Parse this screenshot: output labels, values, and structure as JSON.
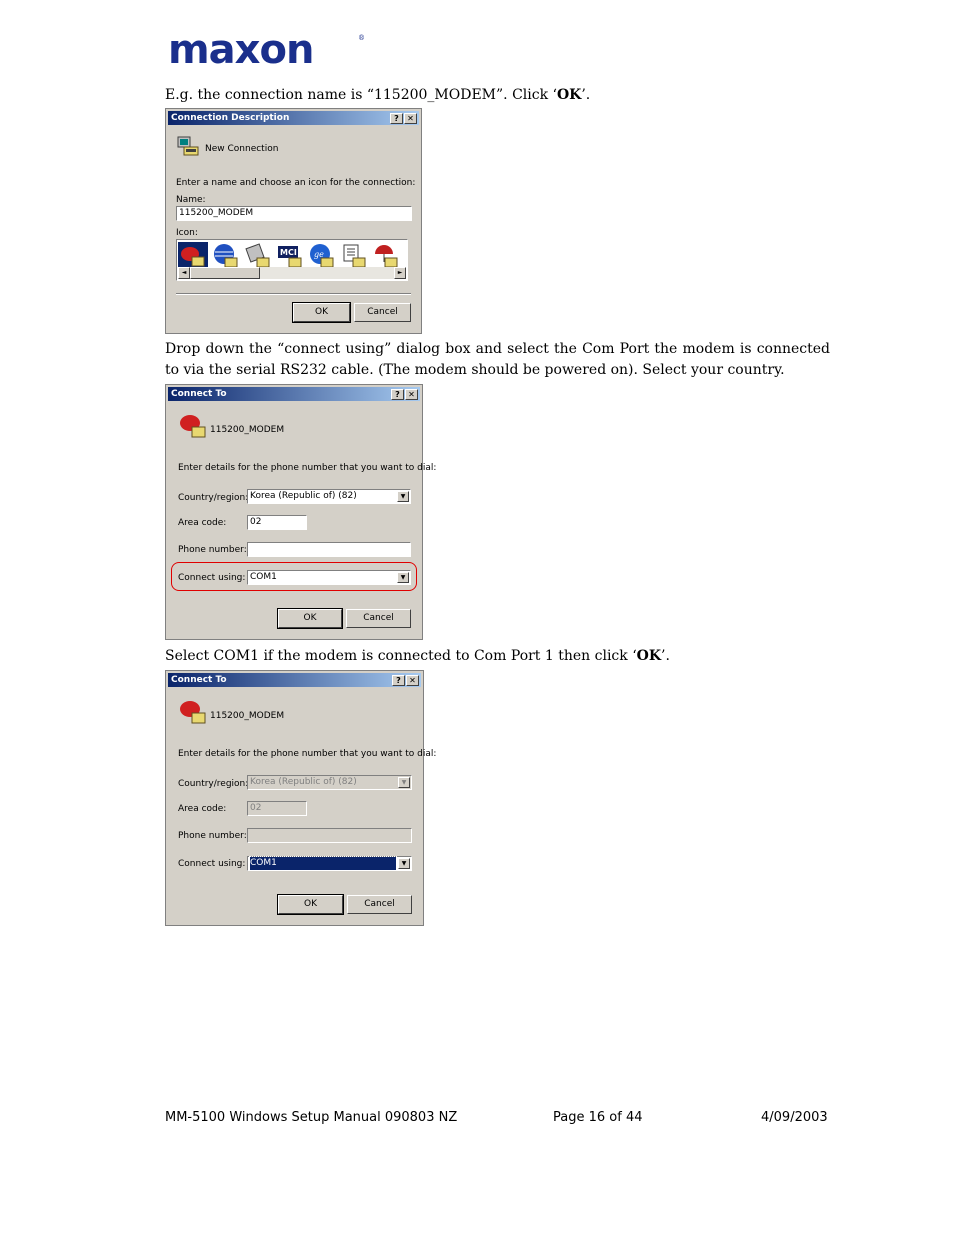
{
  "logo": {
    "text": "maxon",
    "reg": "®"
  },
  "para1": {
    "prefix": "E.g. the connection name is “115200_MODEM”. Click ‘",
    "bold": "OK",
    "suffix": "’."
  },
  "dialog1": {
    "title": "Connection Description",
    "help_btn": "?",
    "close_btn": "✕",
    "heading": "New Connection",
    "instruction": "Enter a name and choose an icon for the connection:",
    "name_label": "Name:",
    "name_value": "115200_MODEM",
    "icon_label": "Icon:",
    "ok": "OK",
    "cancel": "Cancel",
    "scroll_left": "◄",
    "scroll_right": "►"
  },
  "para2": "Drop down the “connect using” dialog box and select the Com Port the modem is connected to via the serial RS232 cable. (The modem should be powered on). Select your country.",
  "dialog2": {
    "title": "Connect To",
    "help_btn": "?",
    "close_btn": "✕",
    "heading": "115200_MODEM",
    "instruction": "Enter details for the phone number that you want to dial:",
    "country_label": "Country/region:",
    "country_value": "Korea (Republic of) (82)",
    "area_label": "Area code:",
    "area_value": "02",
    "phone_label": "Phone number:",
    "phone_value": "",
    "connect_label": "Connect using:",
    "connect_value": "COM1",
    "ok": "OK",
    "cancel": "Cancel",
    "arrow": "▼",
    "highlight_color": "#e00000"
  },
  "para3": {
    "prefix": "Select COM1 if the modem is connected to Com Port 1 then click ‘",
    "bold": "OK",
    "suffix": "’."
  },
  "dialog3": {
    "title": "Connect To",
    "help_btn": "?",
    "close_btn": "✕",
    "heading": "115200_MODEM",
    "instruction": "Enter details for the phone number that you want to dial:",
    "country_label": "Country/region:",
    "country_value": "Korea (Republic of) (82)",
    "area_label": "Area code:",
    "area_value": "02",
    "phone_label": "Phone number:",
    "phone_value": "",
    "connect_label": "Connect using:",
    "connect_value": "COM1",
    "ok": "OK",
    "cancel": "Cancel",
    "arrow": "▼"
  },
  "footer": {
    "doc": "MM-5100 Windows Setup Manual 090803 NZ",
    "page": "Page 16 of 44",
    "date": "4/09/2003"
  },
  "colors": {
    "brand": "#1a2f8c",
    "titlebar": "#0a246a",
    "dialog_bg": "#d4d0c8",
    "selection": "#0a246a"
  }
}
